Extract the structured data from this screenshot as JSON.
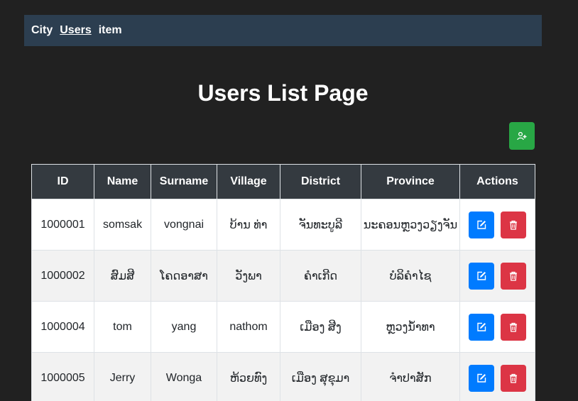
{
  "navbar": {
    "links": [
      {
        "label": "City"
      },
      {
        "label": "Users"
      },
      {
        "label": "item"
      }
    ]
  },
  "page": {
    "title": "Users List Page"
  },
  "add_button": {
    "icon": "user-plus-icon",
    "color": "#28a745"
  },
  "table": {
    "headers": [
      "ID",
      "Name",
      "Surname",
      "Village",
      "District",
      "Province",
      "Actions"
    ],
    "rows": [
      {
        "id": "1000001",
        "name": "somsak",
        "surname": "vongnai",
        "village": "ບ້ານ ທ່າ",
        "district": "ຈັນທະບູລີ",
        "province": "ນະຄອນຫຼວງວຽງຈັນ"
      },
      {
        "id": "1000002",
        "name": "ສົມສີ",
        "surname": "ໂຄດອາສາ",
        "village": "ວັງພາ",
        "district": "ຄຳເກີດ",
        "province": "ບໍລິຄໍາໄຊ"
      },
      {
        "id": "1000004",
        "name": "tom",
        "surname": "yang",
        "village": "nathom",
        "district": "ເມືອງ ສີງ",
        "province": "ຫຼວງນໍ້າທາ"
      },
      {
        "id": "1000005",
        "name": "Jerry",
        "surname": "Wonga",
        "village": "ຫ້ວຍທົງ",
        "district": "ເມືອງ ສຸຂຸມາ",
        "province": "ຈໍາປາສັກ"
      }
    ],
    "edit_icon": "edit-icon",
    "delete_icon": "trash-icon"
  },
  "colors": {
    "background": "#212121",
    "navbar": "#2c3e50",
    "table_header": "#343a40",
    "edit": "#007bff",
    "delete": "#dc3545",
    "add": "#28a745"
  }
}
